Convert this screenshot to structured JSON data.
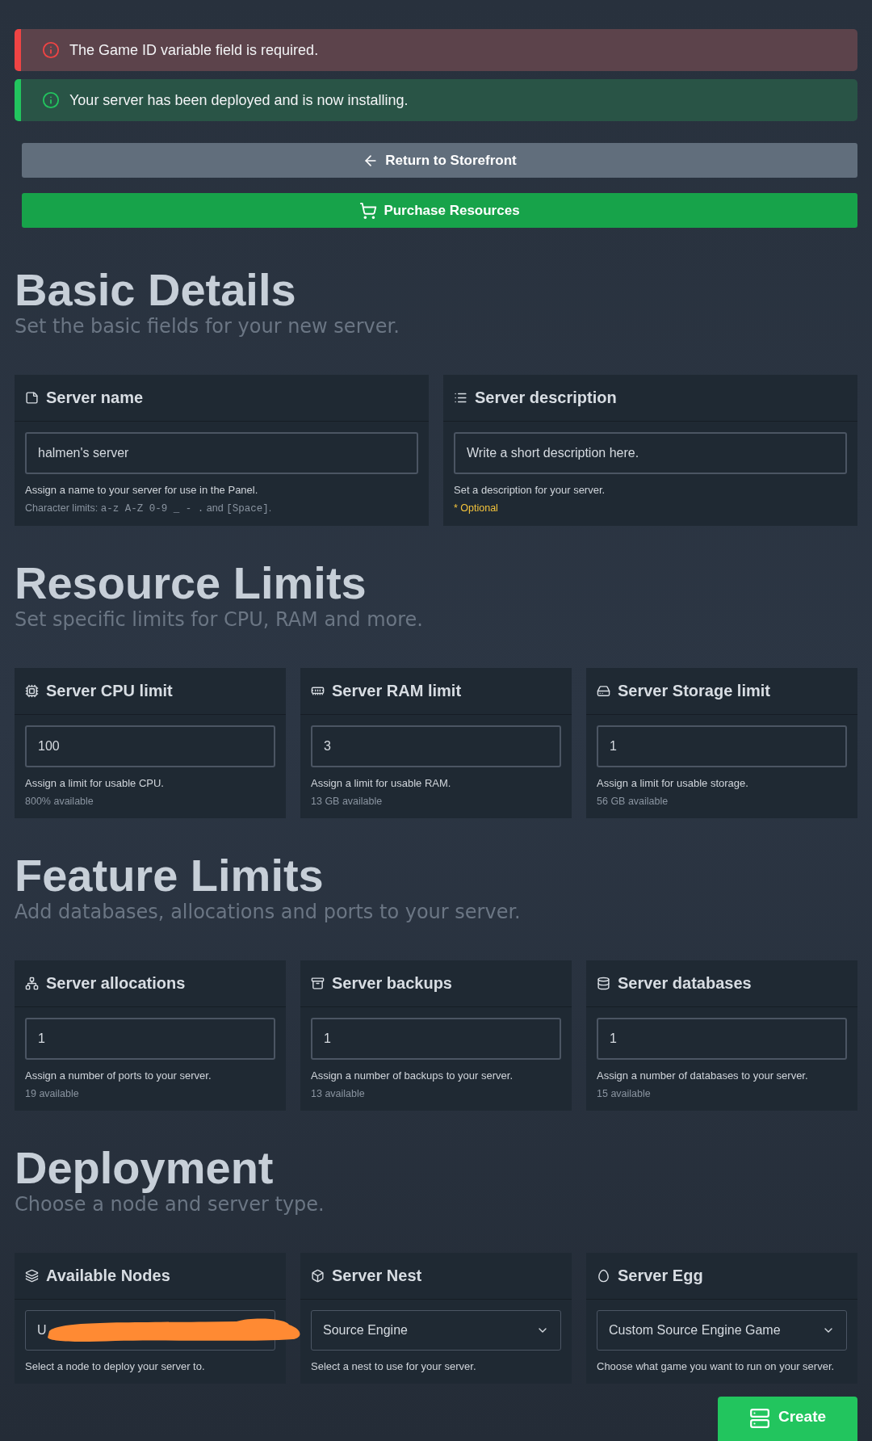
{
  "alerts": [
    {
      "kind": "error",
      "text": "The Game ID variable field is required."
    },
    {
      "kind": "success",
      "text": "Your server has been deployed and is now installing."
    }
  ],
  "actions": [
    {
      "kind": "secondary",
      "label": "Return to Storefront"
    },
    {
      "kind": "primary",
      "label": "Purchase Resources"
    }
  ],
  "sections": [
    {
      "title": "Basic Details",
      "subtitle": "Set the basic fields for your new server.",
      "cards": [
        {
          "title": "Server name",
          "field": {
            "kind": "input",
            "value": "halmen's server"
          },
          "help": "Assign a name to your server for use in the Panel.",
          "note": {
            "kind": "muted",
            "parts": [
              {
                "text": "Character limits: ",
                "mono": false
              },
              {
                "text": "a-z A-Z 0-9 _ - .",
                "mono": true
              },
              {
                "text": " and ",
                "mono": false
              },
              {
                "text": "[Space]",
                "mono": true
              },
              {
                "text": ".",
                "mono": false
              }
            ]
          }
        },
        {
          "title": "Server description",
          "field": {
            "kind": "input",
            "placeholder": "Write a short description here."
          },
          "help": "Set a description for your server.",
          "note": {
            "kind": "optional",
            "parts": [
              {
                "text": "* Optional",
                "mono": false
              }
            ]
          }
        }
      ]
    },
    {
      "title": "Resource Limits",
      "subtitle": "Set specific limits for CPU, RAM and more.",
      "cards": [
        {
          "title": "Server CPU limit",
          "field": {
            "kind": "input",
            "value": "100"
          },
          "help": "Assign a limit for usable CPU.",
          "note": {
            "kind": "muted",
            "parts": [
              {
                "text": "800% available",
                "mono": false
              }
            ]
          }
        },
        {
          "title": "Server RAM limit",
          "field": {
            "kind": "input",
            "value": "3"
          },
          "help": "Assign a limit for usable RAM.",
          "note": {
            "kind": "muted",
            "parts": [
              {
                "text": "13 GB available",
                "mono": false
              }
            ]
          }
        },
        {
          "title": "Server Storage limit",
          "field": {
            "kind": "input",
            "value": "1"
          },
          "help": "Assign a limit for usable storage.",
          "note": {
            "kind": "muted",
            "parts": [
              {
                "text": "56 GB available",
                "mono": false
              }
            ]
          }
        }
      ]
    },
    {
      "title": "Feature Limits",
      "subtitle": "Add databases, allocations and ports to your server.",
      "cards": [
        {
          "title": "Server allocations",
          "field": {
            "kind": "input",
            "value": "1"
          },
          "help": "Assign a number of ports to your server.",
          "note": {
            "kind": "muted",
            "parts": [
              {
                "text": "19 available",
                "mono": false
              }
            ]
          }
        },
        {
          "title": "Server backups",
          "field": {
            "kind": "input",
            "value": "1"
          },
          "help": "Assign a number of backups to your server.",
          "note": {
            "kind": "muted",
            "parts": [
              {
                "text": "13 available",
                "mono": false
              }
            ]
          }
        },
        {
          "title": "Server databases",
          "field": {
            "kind": "input",
            "value": "1"
          },
          "help": "Assign a number of databases to your server.",
          "note": {
            "kind": "muted",
            "parts": [
              {
                "text": "15 available",
                "mono": false
              }
            ]
          }
        }
      ]
    },
    {
      "title": "Deployment",
      "subtitle": "Choose a node and server type.",
      "cards": [
        {
          "title": "Available Nodes",
          "field": {
            "kind": "select",
            "value": "U",
            "redacted": true
          },
          "help": "Select a node to deploy your server to."
        },
        {
          "title": "Server Nest",
          "field": {
            "kind": "select",
            "value": "Source Engine",
            "redacted": false
          },
          "help": "Select a nest to use for your server."
        },
        {
          "title": "Server Egg",
          "field": {
            "kind": "select",
            "value": "Custom Source Engine Game",
            "redacted": false
          },
          "help": "Choose what game you want to run on your server."
        }
      ]
    }
  ],
  "submit": {
    "label": "Create"
  }
}
